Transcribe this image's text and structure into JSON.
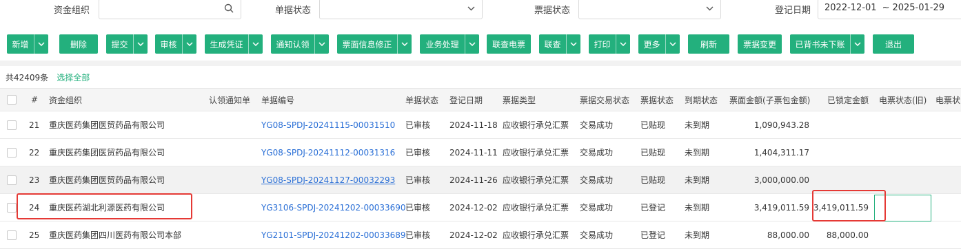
{
  "filters": {
    "fund_org_label": "资金组织",
    "fund_org_value": "",
    "doc_status_label": "单据状态",
    "doc_status_value": "",
    "bill_status_label": "票据状态",
    "bill_status_value": "",
    "reg_date_label": "登记日期",
    "date_from": "2022-12-01",
    "date_sep": "~",
    "date_to": "2025-01-29"
  },
  "toolbar": {
    "buttons": [
      {
        "label": "新增",
        "dropdown": true
      },
      {
        "label": "删除",
        "dropdown": false
      },
      {
        "label": "提交",
        "dropdown": true
      },
      {
        "label": "审核",
        "dropdown": true
      },
      {
        "label": "生成凭证",
        "dropdown": true
      },
      {
        "label": "通知认领",
        "dropdown": true
      },
      {
        "label": "票面信息修正",
        "dropdown": true
      },
      {
        "label": "业务处理",
        "dropdown": true
      },
      {
        "label": "联查电票",
        "dropdown": false
      },
      {
        "label": "联查",
        "dropdown": true
      },
      {
        "label": "打印",
        "dropdown": true
      },
      {
        "label": "更多",
        "dropdown": true
      },
      {
        "label": "刷新",
        "dropdown": false
      },
      {
        "label": "票据变更",
        "dropdown": false
      },
      {
        "label": "已背书未下账",
        "dropdown": true
      },
      {
        "label": "退出",
        "dropdown": false
      }
    ]
  },
  "summary": {
    "total": "共42409条",
    "select_all": "选择全部"
  },
  "table": {
    "columns": [
      "#",
      "资金组织",
      "认领通知单",
      "单据编号",
      "单据状态",
      "登记日期",
      "票据类型",
      "票据交易状态",
      "票据状态",
      "到期状态",
      "票面金额(子票包金额)",
      "已锁定金额",
      "电票状态(旧)",
      "电票状"
    ],
    "rows": [
      {
        "no": "21",
        "org": "重庆医药集团医贸药品有限公司",
        "claim": "",
        "code": "YG08-SPDJ-20241115-00031510",
        "doc_status": "已审核",
        "date": "2024-11-18",
        "type": "应收银行承兑汇票",
        "trade_status": "交易成功",
        "bill_status": "已贴现",
        "due_status": "未到期",
        "amount": "1,090,943.28",
        "locked": "",
        "ebill_old": ""
      },
      {
        "no": "22",
        "org": "重庆医药集团医贸药品有限公司",
        "claim": "",
        "code": "YG08-SPDJ-20241112-00031316",
        "doc_status": "已审核",
        "date": "2024-11-11",
        "type": "应收银行承兑汇票",
        "trade_status": "交易成功",
        "bill_status": "已贴现",
        "due_status": "未到期",
        "amount": "1,404,311.17",
        "locked": "",
        "ebill_old": ""
      },
      {
        "no": "23",
        "org": "重庆医药集团医贸药品有限公司",
        "claim": "",
        "code": "YG08-SPDJ-20241127-00032293",
        "doc_status": "已审核",
        "date": "2024-11-26",
        "type": "应收银行承兑汇票",
        "trade_status": "交易成功",
        "bill_status": "已贴现",
        "due_status": "未到期",
        "amount": "3,000,000.00",
        "locked": "",
        "ebill_old": ""
      },
      {
        "no": "24",
        "org": "重庆医药湖北利源医药有限公司",
        "claim": "",
        "code": "YG3106-SPDJ-20241202-00033690",
        "doc_status": "已审核",
        "date": "2024-12-02",
        "type": "应收银行承兑汇票",
        "trade_status": "交易成功",
        "bill_status": "已登记",
        "due_status": "未到期",
        "amount": "3,419,011.59",
        "locked": "3,419,011.59",
        "ebill_old": ""
      },
      {
        "no": "25",
        "org": "重庆医药集团四川医药有限公司本部",
        "claim": "",
        "code": "YG2101-SPDJ-20241202-00033689",
        "doc_status": "已审核",
        "date": "2024-12-02",
        "type": "应收银行承兑汇票",
        "trade_status": "交易成功",
        "bill_status": "已登记",
        "due_status": "未到期",
        "amount": "88,000.00",
        "locked": "88,000.00",
        "ebill_old": ""
      }
    ]
  },
  "colors": {
    "accent": "#23b07d",
    "link": "#2a6fd6",
    "highlight": "#e53935"
  }
}
